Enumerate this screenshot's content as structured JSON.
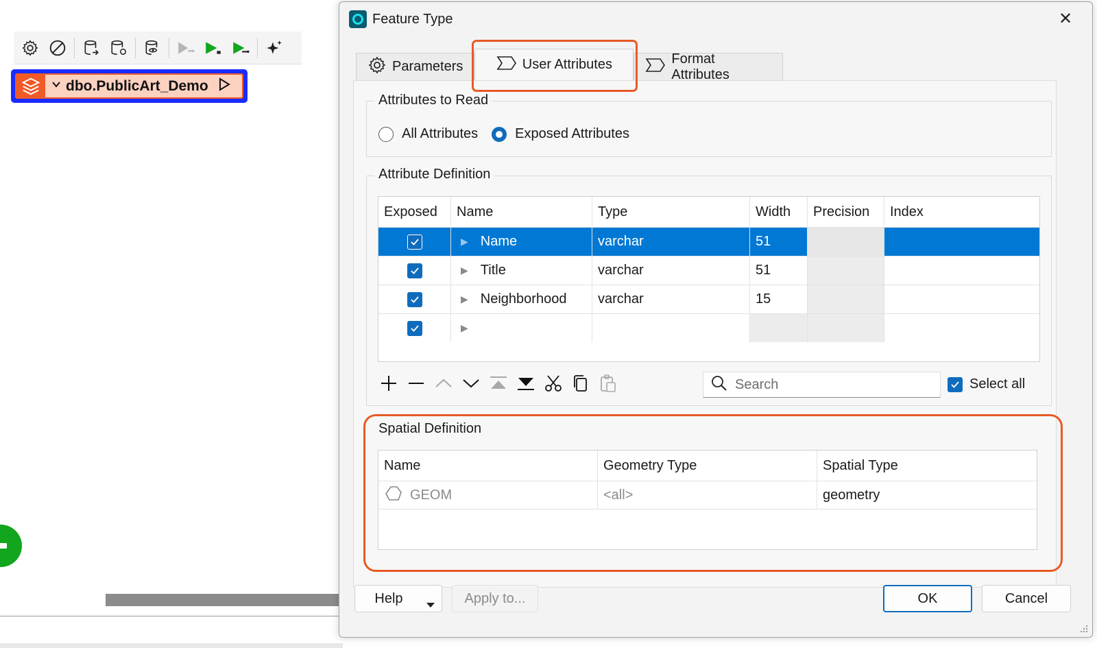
{
  "background": {
    "node_label": "dbo.PublicArt_Demo"
  },
  "dialog": {
    "title": "Feature Type",
    "close_symbol": "✕",
    "tabs": [
      {
        "label": "Parameters",
        "icon": "gear-icon"
      },
      {
        "label": "User Attributes",
        "icon": "attribute-chevron-icon"
      },
      {
        "label": "Format Attributes",
        "icon": "attribute-chevron-icon"
      }
    ],
    "active_tab": "User Attributes",
    "attributes_to_read": {
      "title": "Attributes to Read",
      "options": [
        "All Attributes",
        "Exposed Attributes"
      ],
      "selected": "Exposed Attributes"
    },
    "attribute_definition": {
      "title": "Attribute Definition",
      "columns": [
        "Exposed",
        "Name",
        "Type",
        "Width",
        "Precision",
        "Index"
      ],
      "rows": [
        {
          "exposed": true,
          "name": "Name",
          "type": "varchar",
          "width": "51",
          "precision": "",
          "index": "",
          "selected": true
        },
        {
          "exposed": true,
          "name": "Title",
          "type": "varchar",
          "width": "51",
          "precision": "",
          "index": "",
          "selected": false
        },
        {
          "exposed": true,
          "name": "Neighborhood",
          "type": "varchar",
          "width": "15",
          "precision": "",
          "index": "",
          "selected": false
        },
        {
          "exposed": true,
          "name": "",
          "type": "",
          "width": "",
          "precision": "",
          "index": "",
          "selected": false
        }
      ],
      "search_placeholder": "Search",
      "select_all_label": "Select all"
    },
    "spatial_definition": {
      "title": "Spatial Definition",
      "columns": [
        "Name",
        "Geometry Type",
        "Spatial Type"
      ],
      "rows": [
        {
          "name": "GEOM",
          "geometry_type": "<all>",
          "spatial_type": "geometry"
        }
      ]
    },
    "buttons": {
      "help": "Help",
      "apply_to": "Apply to...",
      "ok": "OK",
      "cancel": "Cancel"
    }
  },
  "colors": {
    "accent": "#0f6cbd",
    "selection": "#0078d4",
    "highlight_orange": "#e85a25",
    "node_border": "#1a2bff",
    "run_green": "#12a51e"
  }
}
